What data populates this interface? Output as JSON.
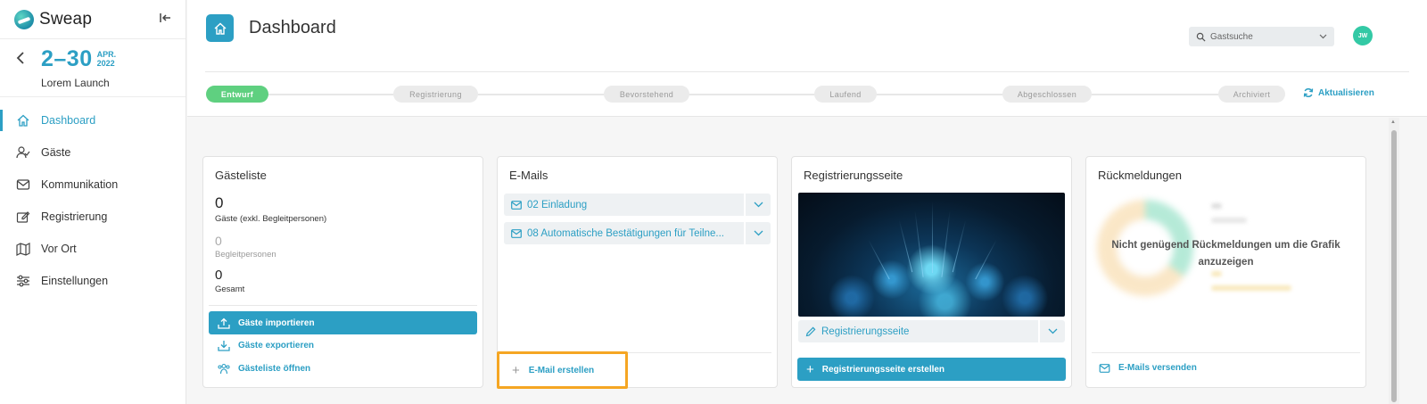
{
  "app": {
    "name": "Sweap"
  },
  "event": {
    "date_range": "2–30",
    "month": "APR.",
    "year": "2022",
    "name": "Lorem Launch"
  },
  "sidebar": {
    "items": [
      {
        "label": "Dashboard",
        "icon": "home-icon",
        "active": true
      },
      {
        "label": "Gäste",
        "icon": "user-check-icon",
        "active": false
      },
      {
        "label": "Kommunikation",
        "icon": "mail-icon",
        "active": false
      },
      {
        "label": "Registrierung",
        "icon": "edit-form-icon",
        "active": false
      },
      {
        "label": "Vor Ort",
        "icon": "map-icon",
        "active": false
      },
      {
        "label": "Einstellungen",
        "icon": "sliders-icon",
        "active": false
      }
    ]
  },
  "header": {
    "title": "Dashboard",
    "search_placeholder": "Gastsuche",
    "avatar_initials": "JW",
    "refresh_label": "Aktualisieren"
  },
  "stages": [
    {
      "label": "Entwurf",
      "active": true
    },
    {
      "label": "Registrierung",
      "active": false
    },
    {
      "label": "Bevorstehend",
      "active": false
    },
    {
      "label": "Laufend",
      "active": false
    },
    {
      "label": "Abgeschlossen",
      "active": false
    },
    {
      "label": "Archiviert",
      "active": false
    }
  ],
  "guest_card": {
    "title": "Gästeliste",
    "guests_value": "0",
    "guests_label": "Gäste (exkl. Begleitpersonen)",
    "companions_value": "0",
    "companions_label": "Begleitpersonen",
    "total_value": "0",
    "total_label": "Gesamt",
    "import_label": "Gäste importieren",
    "export_label": "Gäste exportieren",
    "open_label": "Gästeliste öffnen"
  },
  "email_card": {
    "title": "E-Mails",
    "emails": [
      {
        "label": "02 Einladung"
      },
      {
        "label": "08 Automatische Bestätigungen für Teilne..."
      }
    ],
    "create_label": "E-Mail erstellen"
  },
  "registration_card": {
    "title": "Registrierungsseite",
    "page_label": "Registrierungsseite",
    "create_label": "Registrierungsseite erstellen"
  },
  "feedback_card": {
    "title": "Rückmeldungen",
    "empty_message": "Nicht genügend Rückmeldungen um die Grafik anzuzeigen",
    "send_label": "E-Mails versenden"
  },
  "colors": {
    "accent": "#2c9fc4",
    "active_stage": "#5fd080",
    "highlight": "#f5a623"
  }
}
